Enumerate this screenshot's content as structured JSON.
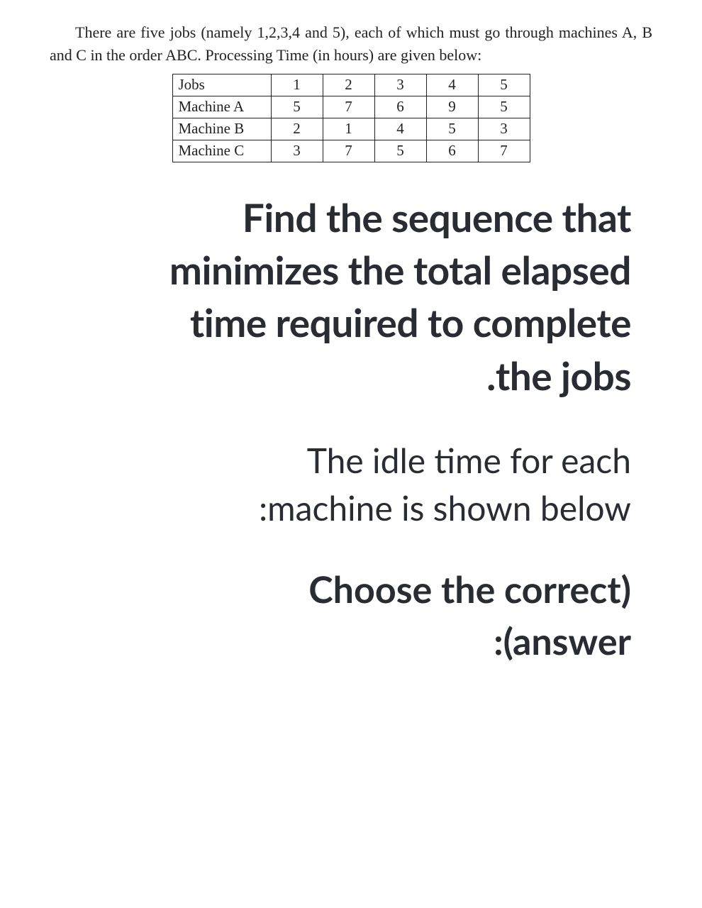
{
  "problem": {
    "statement": "There are five jobs (namely 1,2,3,4 and 5), each of which must go through machines A, B and C in the order ABC.  Processing Time (in hours) are given below:"
  },
  "table": {
    "header_label": "Jobs",
    "jobs": [
      "1",
      "2",
      "3",
      "4",
      "5"
    ],
    "rows": [
      {
        "label": "Machine A",
        "values": [
          "5",
          "7",
          "6",
          "9",
          "5"
        ]
      },
      {
        "label": "Machine B",
        "values": [
          "2",
          "1",
          "4",
          "5",
          "3"
        ]
      },
      {
        "label": "Machine C",
        "values": [
          "3",
          "7",
          "5",
          "6",
          "7"
        ]
      }
    ]
  },
  "question": {
    "main_line1": "Find the sequence that",
    "main_line2": "minimizes the total elapsed",
    "main_line3": "time required to complete",
    "main_line4": ".the jobs",
    "sub_line1": "The idle time for each",
    "sub_line2": ":machine is shown below",
    "choose_line1": "Choose the correct)",
    "choose_line2": ":(answer"
  },
  "chart_data": {
    "type": "table",
    "title": "Processing Time (in hours)",
    "columns": [
      "Jobs",
      "1",
      "2",
      "3",
      "4",
      "5"
    ],
    "rows": [
      [
        "Machine A",
        5,
        7,
        6,
        9,
        5
      ],
      [
        "Machine B",
        2,
        1,
        4,
        5,
        3
      ],
      [
        "Machine C",
        3,
        7,
        5,
        6,
        7
      ]
    ]
  }
}
